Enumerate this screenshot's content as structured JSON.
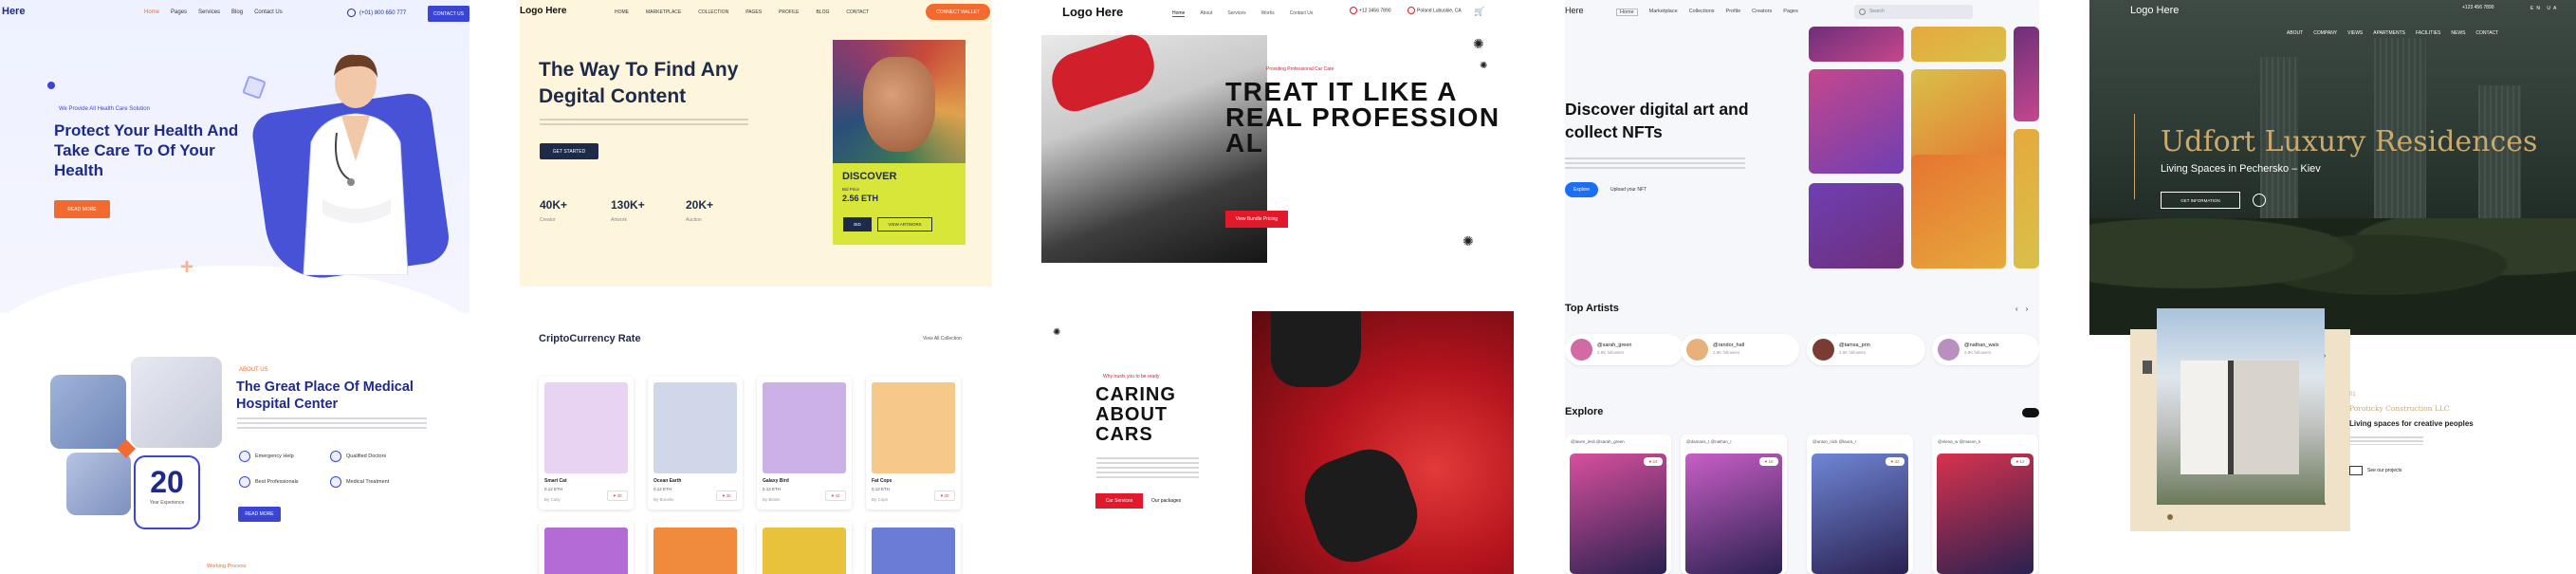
{
  "medical": {
    "logo": "Here",
    "nav": [
      "Home",
      "Pages",
      "Services",
      "Blog",
      "Contact Us"
    ],
    "phone": "(+01) 800 650 777",
    "contact_button": "CONTACT US",
    "eyebrow": "We Provide All Health Care Solution",
    "headline": "Protect Your Health And Take Care To Of Your Health",
    "hero_button": "READ MORE",
    "section_eyebrow": "ABOUT US",
    "section_title": "The Great Place Of Medical Hospital Center",
    "features": [
      "Emergency Help",
      "Qualified Doctors",
      "Best Professionals",
      "Medical Treatment"
    ],
    "experience_number": "20",
    "experience_label": "Year Experience",
    "section_button": "READ MORE",
    "footer_label": "Working Process"
  },
  "content": {
    "logo": "Logo Here",
    "nav": [
      "HOME",
      "MARKETPLACE",
      "COLLECTION",
      "PAGES",
      "PROFILE",
      "BLOG",
      "CONTACT"
    ],
    "cta_button": "CONNECT WALLET",
    "headline": "The Way To Find Any Degital Content",
    "hero_button": "GET STARTED",
    "stats": [
      {
        "value": "40K+",
        "label": "Creator"
      },
      {
        "value": "130K+",
        "label": "Artwork"
      },
      {
        "value": "20K+",
        "label": "Auction"
      }
    ],
    "discover": {
      "title": "DISCOVER",
      "subtitle": "Bid Price",
      "price": "2.56 ETH",
      "buy_label": "BID",
      "view_label": "VIEW ARTWORK"
    },
    "section_title": "CriptoCurrency Rate",
    "view_all": "View All Collection",
    "cards": [
      {
        "name": "Smart Cat",
        "price": "0.12 ETH",
        "author": "By Cutiy",
        "likes": "30",
        "color": "#e9d3f2"
      },
      {
        "name": "Ocean Earth",
        "price": "0.12 ETH",
        "author": "By Bonelio",
        "likes": "40",
        "color": "#cfd7e8"
      },
      {
        "name": "Galaxy Bird",
        "price": "0.12 ETH",
        "author": "By Birder",
        "likes": "42",
        "color": "#cbb1e6"
      },
      {
        "name": "Fat Cops",
        "price": "0.12 ETH",
        "author": "By Cops",
        "likes": "20",
        "color": "#f6c98a"
      }
    ],
    "cards_row2_colors": [
      "#b46bd6",
      "#f08a3c",
      "#e8c23a",
      "#6b7cd6"
    ]
  },
  "cars": {
    "logo": "Logo Here",
    "nav": [
      "Home",
      "About",
      "Services",
      "Works",
      "Contact Us"
    ],
    "phone": "+12 3456 7890",
    "address": "Poland Lubuskie, CA",
    "eyebrow": "Providing Professional Car Care",
    "headline": "TREAT IT LIKE A REAL PROFESSION AL",
    "hero_button": "View Bundle Pricing",
    "section_eyebrow": "Why trusts you to be ready",
    "section_title": "CARING ABOUT CARS",
    "section_button": "Car Services",
    "section_link": "Our packages"
  },
  "nft": {
    "logo": "Here",
    "nav": [
      "Home",
      "Marketplace",
      "Collections",
      "Profile",
      "Creators",
      "Pages"
    ],
    "search_placeholder": "Search",
    "headline": "Discover digital art and collect NFTs",
    "hero_button": "Explore",
    "hero_link": "Upload your NFT",
    "artists_title": "Top Artists",
    "artists": [
      {
        "handle": "@sarah_green",
        "followers": "2.8K followers",
        "color": "#d26aa3"
      },
      {
        "handle": "@randor_hall",
        "followers": "2.8K followers",
        "color": "#e6b17a"
      },
      {
        "handle": "@tamsa_prin",
        "followers": "2.8K followers",
        "color": "#7a3b32"
      },
      {
        "handle": "@nathan_wals",
        "followers": "2.8K followers",
        "color": "#b98fc0"
      }
    ],
    "explore_title": "Explore",
    "nft_cards": [
      {
        "meta": "@laven_lesli    @sarah_green",
        "likes": "24",
        "color": "#d84f9d"
      },
      {
        "meta": "@damaris_t    @nathan_r",
        "likes": "18",
        "color": "#c95ec6"
      },
      {
        "meta": "@anton_nick    @laura_r",
        "likes": "32",
        "color": "#6f86d6"
      },
      {
        "meta": "@elena_w    @mason_k",
        "likes": "12",
        "color": "#d8324e"
      }
    ],
    "tile_colors": [
      "#6e2f7a",
      "#e6a93d",
      "#c5478c",
      "#d9c04a",
      "#6f3fb2",
      "#e67530"
    ]
  },
  "residence": {
    "logo": "Logo Here",
    "phone": "+123 456 7890",
    "languages": "EN  UA",
    "nav": [
      "ABOUT",
      "COMPANY",
      "VIEWS",
      "APARTMENTS",
      "FACILITIES",
      "NEWS",
      "CONTACT"
    ],
    "headline": "Udfort Luxury Residences",
    "subheadline": "Living Spaces in Pechersko – Kiev",
    "hero_button": "GET INFORMATION",
    "section_number": "01",
    "company": "Poroticky Construction LLC",
    "section_title": "Living spaces for creative peoples",
    "projects_link": "See our projects"
  }
}
